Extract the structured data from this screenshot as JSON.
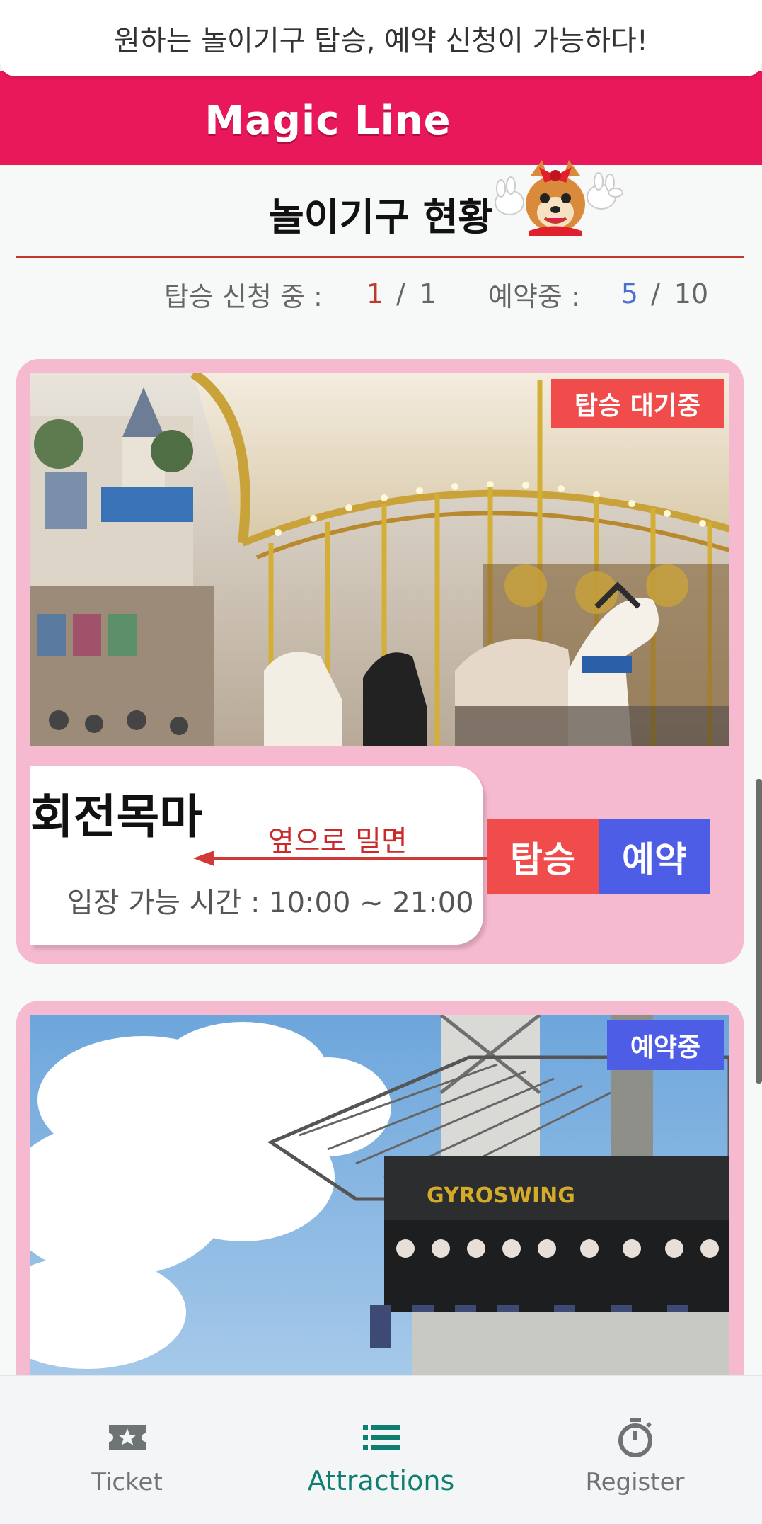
{
  "banner": {
    "message": "원하는 놀이기구 탑승, 예약 신청이 가능하다!"
  },
  "brand": {
    "name": "Magic Line"
  },
  "page": {
    "title": "놀이기구 현황"
  },
  "stats": {
    "ride_label": "탑승 신청 중 :",
    "ride_current": "1",
    "ride_sep": "/",
    "ride_max": "1",
    "reserve_label": "예약중 :",
    "reserve_current": "5",
    "reserve_sep": "/",
    "reserve_max": "10"
  },
  "attractions": [
    {
      "name": "회전목마",
      "status": "탑승 대기중",
      "status_color": "#f04c4c",
      "hours": "입장 가능 시간 : 10:00 ~ 21:00",
      "swipe_hint": "옆으로 밀면",
      "ride_button": "탑승",
      "reserve_button": "예약"
    },
    {
      "status": "예약중",
      "status_color": "#4e5de6"
    }
  ],
  "nav": {
    "items": [
      {
        "label": "Ticket",
        "icon": "ticket-star-icon"
      },
      {
        "label": "Attractions",
        "icon": "list-icon",
        "active": true
      },
      {
        "label": "Register",
        "icon": "stopwatch-icon"
      }
    ]
  },
  "colors": {
    "brand": "#e8185a",
    "card": "#f6bad0",
    "ride": "#f04c4c",
    "reserve": "#4e5de6",
    "active_nav": "#0f7d70"
  }
}
